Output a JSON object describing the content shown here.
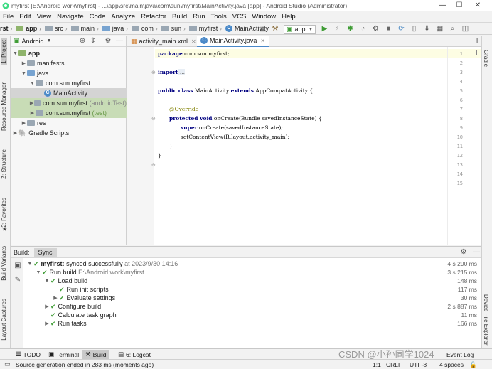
{
  "window": {
    "title": "myfirst [E:\\Android work\\myfirst] - ...\\app\\src\\main\\java\\com\\sun\\myfirst\\MainActivity.java [app] - Android Studio (Administrator)",
    "minimize": "—",
    "maximize": "☐",
    "close": "✕"
  },
  "menu": [
    "File",
    "Edit",
    "View",
    "Navigate",
    "Code",
    "Analyze",
    "Refactor",
    "Build",
    "Run",
    "Tools",
    "VCS",
    "Window",
    "Help"
  ],
  "breadcrumb": {
    "root": "rst",
    "items": [
      "app",
      "src",
      "main",
      "java",
      "com",
      "sun",
      "myfirst",
      "MainActivity"
    ]
  },
  "toolbar": {
    "run_config": "app"
  },
  "left_strip": {
    "project": "1: Project",
    "resource_manager": "Resource Manager",
    "structure": "Z: Structure",
    "favorites": "2: Favorites",
    "build_variants": "Build Variants",
    "layout_captures": "Layout Captures"
  },
  "right_strip": {
    "gradle": "Gradle",
    "device_explorer": "Device File Explorer"
  },
  "project": {
    "view_mode": "Android",
    "tree": [
      {
        "label": "app",
        "bold": true
      },
      {
        "label": "manifests"
      },
      {
        "label": "java"
      },
      {
        "label": "com.sun.myfirst"
      },
      {
        "label": "MainActivity"
      },
      {
        "label": "com.sun.myfirst",
        "suffix": "(androidTest)"
      },
      {
        "label": "com.sun.myfirst",
        "suffix": "(test)"
      },
      {
        "label": "res"
      },
      {
        "label": "Gradle Scripts"
      }
    ]
  },
  "editor": {
    "tabs": [
      {
        "label": "activity_main.xml"
      },
      {
        "label": "MainActivity.java"
      }
    ],
    "line_numbers": [
      "1",
      "2",
      "3",
      "4",
      "5",
      "6",
      "7",
      "8",
      "9",
      "10",
      "11",
      "12",
      "13",
      "14",
      "15"
    ],
    "code": {
      "l1_kw": "package",
      "l1_rest": " com.sun.myfirst;",
      "l3_kw": "import",
      "l3_rest": " ...",
      "l5_kw": "public class",
      "l5_name": " MainActivity ",
      "l5_kw2": "extends",
      "l5_rest": " AppCompatActivity {",
      "l8_ann": "@Override",
      "l9_kw": "protected void",
      "l9_rest": " onCreate(Bundle savedInstanceState) {",
      "l10_kw": "super",
      "l10_rest": ".onCreate(savedInstanceState);",
      "l11": "setContentView(R.layout.activity_main);",
      "l12": "}",
      "l13": "}"
    }
  },
  "build": {
    "tabs": [
      "Build:",
      "Sync"
    ],
    "rows": [
      {
        "label": "myfirst:",
        "detail": "synced successfully",
        "extra": "at 2023/9/30 14:16",
        "time": "4 s 290 ms"
      },
      {
        "label": "Run build",
        "detail": "E:\\Android work\\myfirst",
        "time": "3 s 215 ms"
      },
      {
        "label": "Load build",
        "time": "148 ms"
      },
      {
        "label": "Run init scripts",
        "time": "117 ms"
      },
      {
        "label": "Evaluate settings",
        "time": "30 ms"
      },
      {
        "label": "Configure build",
        "time": "2 s 887 ms"
      },
      {
        "label": "Calculate task graph",
        "time": "11 ms"
      },
      {
        "label": "Run tasks",
        "time": "166 ms"
      }
    ]
  },
  "bottom_tabs": [
    "TODO",
    "Terminal",
    "Build",
    "6: Logcat",
    "Event Log"
  ],
  "status": {
    "message": "Source generation ended in 283 ms (moments ago)",
    "position": "1:1",
    "line_sep": "CRLF",
    "encoding": "UTF-8",
    "indent": "4 spaces"
  },
  "watermark": "CSDN @小孙同学1024"
}
